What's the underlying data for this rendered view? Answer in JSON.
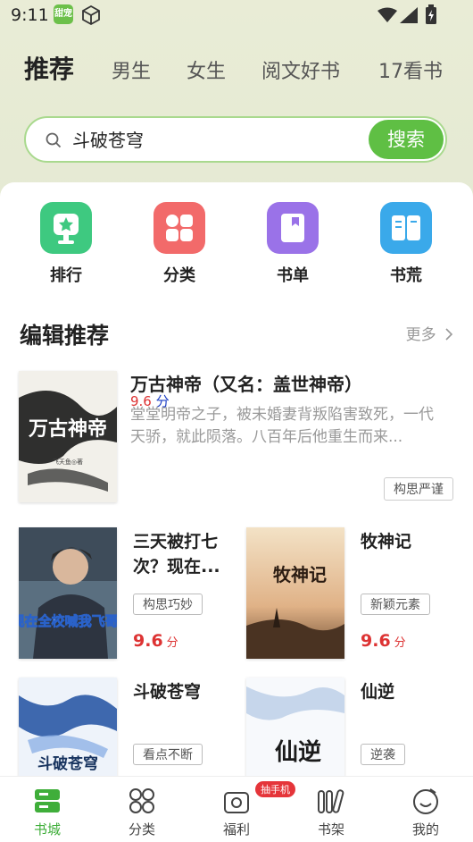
{
  "status": {
    "time": "9:11",
    "app_badge": "甜宠"
  },
  "tabs": [
    "推荐",
    "男生",
    "女生",
    "阅文好书",
    "17看书"
  ],
  "search": {
    "value": "斗破苍穹",
    "button": "搜索"
  },
  "quick_links": [
    {
      "label": "排行",
      "icon": "trophy-icon",
      "color": "#3ec980"
    },
    {
      "label": "分类",
      "icon": "grid-icon",
      "color": "#f26a6a"
    },
    {
      "label": "书单",
      "icon": "booklist-icon",
      "color": "#9a72e8"
    },
    {
      "label": "书荒",
      "icon": "book-open-icon",
      "color": "#3aa9ea"
    }
  ],
  "section": {
    "title": "编辑推荐",
    "more": "更多"
  },
  "featured": {
    "title": "万古神帝（又名：盖世神帝）",
    "score": "9.6",
    "score_unit": "分",
    "description": "堂堂明帝之子，被未婚妻背叛陷害致死，一代天骄，就此陨落。八百年后他重生而来...",
    "tag": "构思严谨",
    "cover_title": "万古神帝",
    "cover_author": "飞天鱼◎著"
  },
  "books": [
    {
      "title": "三天被打七次？现在...",
      "tag": "构思巧妙",
      "score": "9.6",
      "unit": "分",
      "cover_text": "现在全校喊我飞哥!"
    },
    {
      "title": "牧神记",
      "tag": "新颖元素",
      "score": "9.6",
      "unit": "分",
      "cover_text": "牧神记"
    },
    {
      "title": "斗破苍穹",
      "tag": "看点不断",
      "cover_text": "斗破苍穹"
    },
    {
      "title": "仙逆",
      "tag": "逆袭",
      "cover_text": "仙逆"
    }
  ],
  "bottom_nav": [
    {
      "label": "书城",
      "active": true
    },
    {
      "label": "分类",
      "active": false
    },
    {
      "label": "福利",
      "active": false,
      "badge": "抽手机"
    },
    {
      "label": "书架",
      "active": false
    },
    {
      "label": "我的",
      "active": false
    }
  ],
  "colors": {
    "accent": "#5fbf44",
    "score": "#d33333"
  }
}
